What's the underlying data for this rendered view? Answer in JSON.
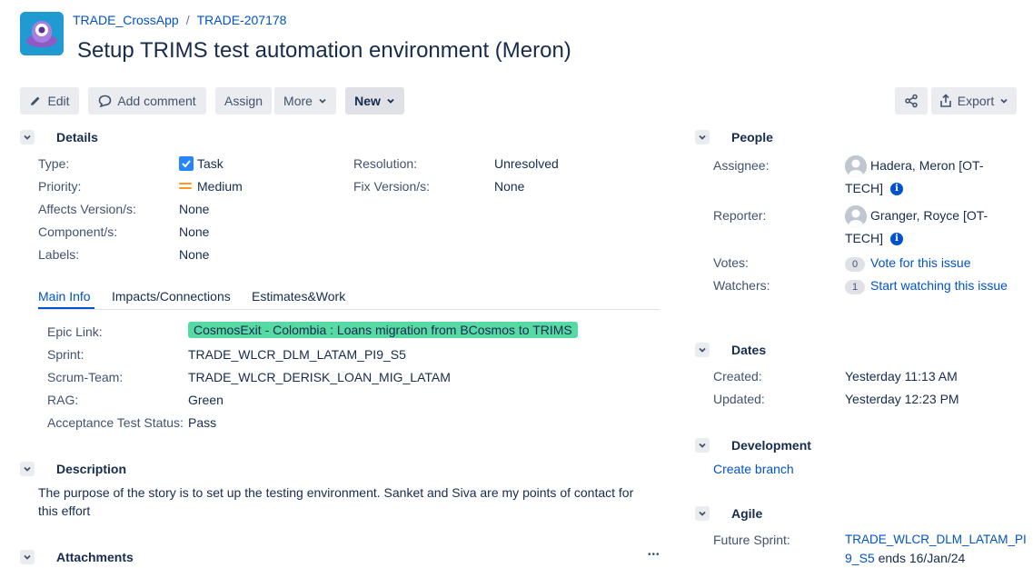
{
  "breadcrumb": {
    "project": "TRADE_CrossApp",
    "separator": "/",
    "issue_key": "TRADE-207178"
  },
  "issue": {
    "title": "Setup TRIMS test automation environment (Meron)"
  },
  "toolbar": {
    "edit": "Edit",
    "add_comment": "Add comment",
    "assign": "Assign",
    "more": "More",
    "new": "New",
    "export": "Export"
  },
  "details": {
    "heading": "Details",
    "type_label": "Type:",
    "type_value": "Task",
    "priority_label": "Priority:",
    "priority_value": "Medium",
    "affects_label": "Affects Version/s:",
    "affects_value": "None",
    "component_label": "Component/s:",
    "component_value": "None",
    "labels_label": "Labels:",
    "labels_value": "None",
    "resolution_label": "Resolution:",
    "resolution_value": "Unresolved",
    "fix_label": "Fix Version/s:",
    "fix_value": "None"
  },
  "tabs": [
    "Main Info",
    "Impacts/Connections",
    "Estimates&Work"
  ],
  "main_info": {
    "epic_label": "Epic Link:",
    "epic_value": "CosmosExit - Colombia : Loans migration from BCosmos to TRIMS",
    "sprint_label": "Sprint:",
    "sprint_value": "TRADE_WLCR_DLM_LATAM_PI9_S5",
    "scrum_label": "Scrum-Team:",
    "scrum_value": "TRADE_WLCR_DERISK_LOAN_MIG_LATAM",
    "rag_label": "RAG:",
    "rag_value": "Green",
    "acceptance_label": "Acceptance Test Status:",
    "acceptance_value": "Pass"
  },
  "description": {
    "heading": "Description",
    "line1": "The purpose of the story is to set up the testing environment. Sanket and Siva are my points of contact for",
    "line2": "this effort"
  },
  "attachments": {
    "heading": "Attachments",
    "more": "•••"
  },
  "people": {
    "heading": "People",
    "assignee_label": "Assignee:",
    "assignee_line1": "Hadera, Meron [OT-",
    "assignee_line2": "TECH]",
    "reporter_label": "Reporter:",
    "reporter_line1": "Granger, Royce [OT-",
    "reporter_line2": "TECH]",
    "votes_label": "Votes:",
    "votes_count": "0",
    "votes_link": "Vote for this issue",
    "watchers_label": "Watchers:",
    "watchers_count": "1",
    "watchers_link": "Start watching this issue"
  },
  "dates": {
    "heading": "Dates",
    "created_label": "Created:",
    "created_value": "Yesterday 11:13 AM",
    "updated_label": "Updated:",
    "updated_value": "Yesterday 12:23 PM"
  },
  "development": {
    "heading": "Development",
    "create_branch": "Create branch"
  },
  "agile": {
    "heading": "Agile",
    "future_label": "Future Sprint:",
    "future_link_line1": "TRADE_WLCR_DLM_LATAM_PI",
    "future_link_line2": "9_S5",
    "future_suffix": " ends 16/Jan/24"
  },
  "colors": {
    "link": "#0052cc",
    "epic": "#57d9a3",
    "priority_medium": "#ff991f",
    "checkbox": "#2684ff"
  }
}
